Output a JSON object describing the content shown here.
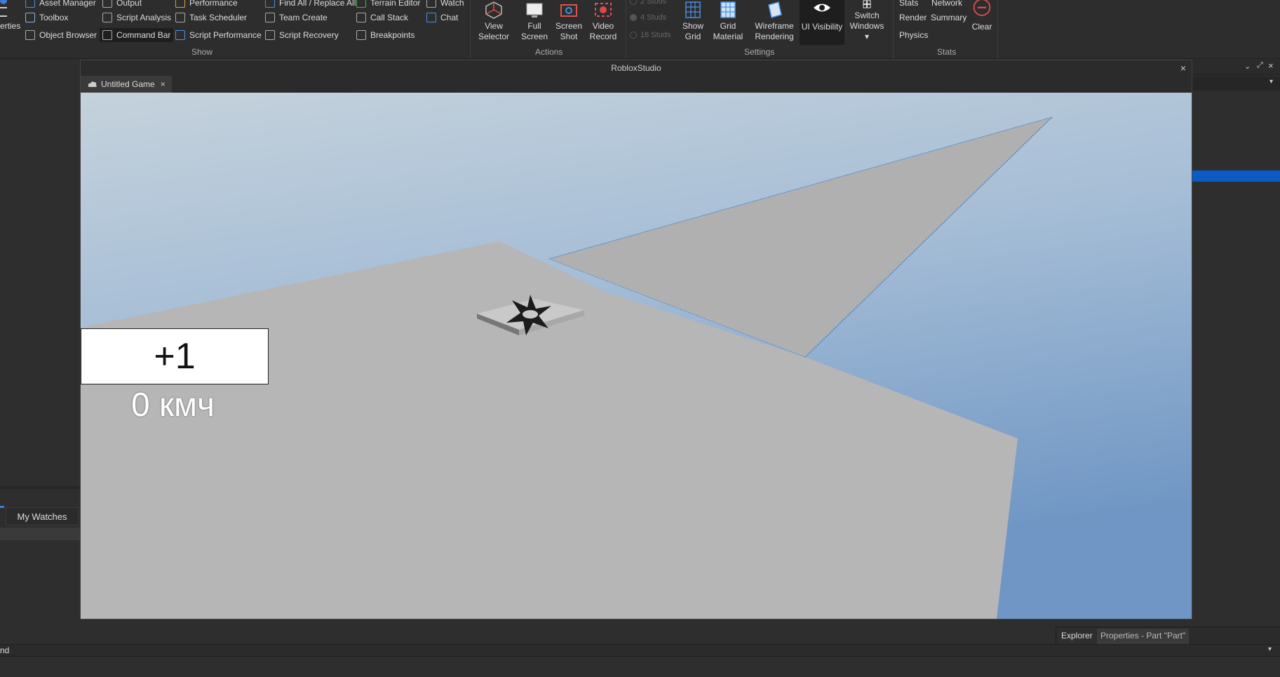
{
  "ribbon": {
    "show_items": [
      {
        "label": "Asset Manager",
        "icon": "asset-manager-icon"
      },
      {
        "label": "Output",
        "icon": "output-icon"
      },
      {
        "label": "Performance",
        "icon": "performance-icon"
      },
      {
        "label": "Find All / Replace All",
        "icon": "find-replace-icon"
      },
      {
        "label": "Terrain Editor",
        "icon": "terrain-editor-icon"
      },
      {
        "label": "Watch",
        "icon": "watch-icon"
      },
      {
        "label": "Toolbox",
        "icon": "toolbox-icon"
      },
      {
        "label": "Script Analysis",
        "icon": "script-analysis-icon"
      },
      {
        "label": "Task Scheduler",
        "icon": "task-scheduler-icon"
      },
      {
        "label": "Team Create",
        "icon": "team-create-icon"
      },
      {
        "label": "Call Stack",
        "icon": "call-stack-icon"
      },
      {
        "label": "Chat",
        "icon": "chat-icon"
      },
      {
        "label": "Object Browser",
        "icon": "object-browser-icon"
      },
      {
        "label": "Command Bar",
        "icon": "command-bar-icon"
      },
      {
        "label": "Script Performance",
        "icon": "script-performance-icon"
      },
      {
        "label": "Script Recovery",
        "icon": "script-recovery-icon"
      },
      {
        "label": "Breakpoints",
        "icon": "breakpoints-icon"
      }
    ],
    "left_partial": "erties",
    "show_label": "Show",
    "actions_label": "Actions",
    "settings_label": "Settings",
    "stats_label": "Stats",
    "actions": [
      {
        "line1": "View",
        "line2": "Selector"
      },
      {
        "line1": "Full",
        "line2": "Screen"
      },
      {
        "line1": "Screen",
        "line2": "Shot"
      },
      {
        "line1": "Video",
        "line2": "Record"
      }
    ],
    "studs": [
      "2 Studs",
      "4 Studs",
      "16 Studs"
    ],
    "settings": [
      {
        "line1": "Show",
        "line2": "Grid"
      },
      {
        "line1": "Grid",
        "line2": "Material"
      },
      {
        "line1": "Wireframe",
        "line2": "Rendering"
      },
      {
        "line1": "UI Visibility",
        "line2": ""
      },
      {
        "line1": "Switch",
        "line2": "Windows ▾"
      }
    ],
    "stats": [
      "Stats",
      "Network",
      "Render",
      "Summary",
      "Physics"
    ],
    "clear_label": "Clear"
  },
  "window": {
    "title": "RobloxStudio",
    "tab_label": "Untitled Game"
  },
  "game": {
    "score": "+1",
    "speed": "0 кмч"
  },
  "panels": {
    "my_watches": "My Watches",
    "explorer_tab": "Explorer",
    "properties_tab": "Properties - Part \"Part\"",
    "command_partial": "nd"
  },
  "colors": {
    "accent": "#0a5bc4",
    "record": "#e04848",
    "sky_top": "#c5d2dc",
    "sky_bottom": "#6f96c4",
    "ground": "#b7b7b7"
  }
}
